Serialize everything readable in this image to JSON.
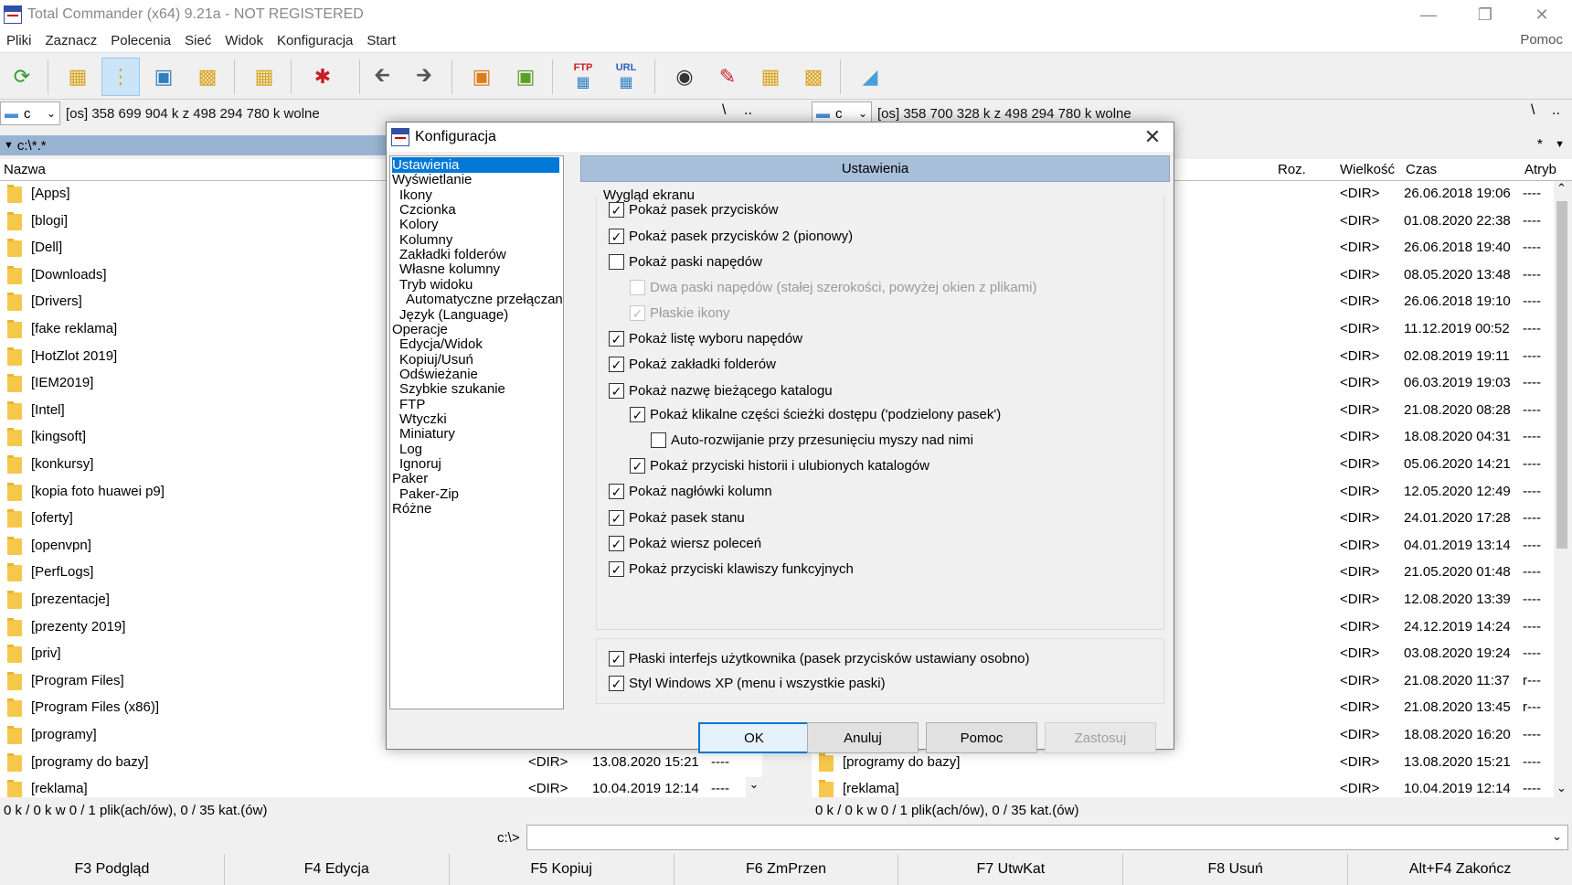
{
  "window": {
    "title": "Total Commander (x64) 9.21a - NOT REGISTERED"
  },
  "menu": {
    "items": [
      "Pliki",
      "Zaznacz",
      "Polecenia",
      "Sieć",
      "Widok",
      "Konfiguracja",
      "Start"
    ],
    "help": "Pomoc"
  },
  "toolbar": {
    "ftp_label": "FTP",
    "url_label": "URL"
  },
  "left_panel": {
    "drive": "c",
    "drive_info": "[os]  358 699 904 k z 498 294 780 k wolne",
    "path_up": "\\",
    "path_dots": "..",
    "path": "c:\\*.*",
    "col_name": "Nazwa",
    "status": "0 k / 0 k w 0 / 1 plik(ach/ów), 0 / 35 kat.(ów)"
  },
  "right_panel": {
    "drive": "c",
    "drive_info": "[os]  358 700 328 k z 498 294 780 k wolne",
    "path_up": "\\",
    "path_dots": "..",
    "star": "*",
    "col_ext": "Roz.",
    "col_size": "Wielkość",
    "col_time": "Czas",
    "col_attr": "Atryb",
    "status": "0 k / 0 k w 0 / 1 plik(ach/ów), 0 / 35 kat.(ów)"
  },
  "files": [
    {
      "name": "[Apps]",
      "size": "<DIR>",
      "time": "26.06.2018 19:06",
      "attr": "----"
    },
    {
      "name": "[blogi]",
      "size": "<DIR>",
      "time": "01.08.2020 22:38",
      "attr": "----"
    },
    {
      "name": "[Dell]",
      "size": "<DIR>",
      "time": "26.06.2018 19:40",
      "attr": "----"
    },
    {
      "name": "[Downloads]",
      "size": "<DIR>",
      "time": "08.05.2020 13:48",
      "attr": "----"
    },
    {
      "name": "[Drivers]",
      "size": "<DIR>",
      "time": "26.06.2018 19:10",
      "attr": "----"
    },
    {
      "name": "[fake reklama]",
      "size": "<DIR>",
      "time": "11.12.2019 00:52",
      "attr": "----"
    },
    {
      "name": "[HotZlot 2019]",
      "size": "<DIR>",
      "time": "02.08.2019 19:11",
      "attr": "----"
    },
    {
      "name": "[IEM2019]",
      "size": "<DIR>",
      "time": "06.03.2019 19:03",
      "attr": "----"
    },
    {
      "name": "[Intel]",
      "size": "<DIR>",
      "time": "21.08.2020 08:28",
      "attr": "----"
    },
    {
      "name": "[kingsoft]",
      "size": "<DIR>",
      "time": "18.08.2020 04:31",
      "attr": "----"
    },
    {
      "name": "[konkursy]",
      "size": "<DIR>",
      "time": "05.06.2020 14:21",
      "attr": "----"
    },
    {
      "name": "[kopia foto huawei p9]",
      "size": "<DIR>",
      "time": "12.05.2020 12:49",
      "attr": "----"
    },
    {
      "name": "[oferty]",
      "size": "<DIR>",
      "time": "24.01.2020 17:28",
      "attr": "----"
    },
    {
      "name": "[openvpn]",
      "size": "<DIR>",
      "time": "04.01.2019 13:14",
      "attr": "----"
    },
    {
      "name": "[PerfLogs]",
      "size": "<DIR>",
      "time": "21.05.2020 01:48",
      "attr": "----"
    },
    {
      "name": "[prezentacje]",
      "size": "<DIR>",
      "time": "12.08.2020 13:39",
      "attr": "----"
    },
    {
      "name": "[prezenty 2019]",
      "size": "<DIR>",
      "time": "24.12.2019 14:24",
      "attr": "----"
    },
    {
      "name": "[priv]",
      "size": "<DIR>",
      "time": "03.08.2020 19:24",
      "attr": "----"
    },
    {
      "name": "[Program Files]",
      "size": "<DIR>",
      "time": "21.08.2020 11:37",
      "attr": "r---"
    },
    {
      "name": "[Program Files (x86)]",
      "size": "<DIR>",
      "time": "21.08.2020 13:45",
      "attr": "r---"
    },
    {
      "name": "[programy]",
      "size": "<DIR>",
      "time": "18.08.2020 16:20",
      "attr": "----"
    },
    {
      "name": "[programy do bazy]",
      "size": "<DIR>",
      "time": "13.08.2020 15:21",
      "attr": "----"
    },
    {
      "name": "[reklama]",
      "size": "<DIR>",
      "time": "10.04.2019 12:14",
      "attr": "----"
    }
  ],
  "cmdline": {
    "label": "c:\\>"
  },
  "fkeys": [
    "F3 Podgląd",
    "F4 Edycja",
    "F5 Kopiuj",
    "F6 ZmPrzen",
    "F7 UtwKat",
    "F8 Usuń",
    "Alt+F4 Zakończ"
  ],
  "dialog": {
    "title": "Konfiguracja",
    "tree": [
      {
        "label": "Ustawienia",
        "level": 0,
        "selected": true
      },
      {
        "label": "Wyświetlanie",
        "level": 0
      },
      {
        "label": "Ikony",
        "level": 1
      },
      {
        "label": "Czcionka",
        "level": 1
      },
      {
        "label": "Kolory",
        "level": 1
      },
      {
        "label": "Kolumny",
        "level": 1
      },
      {
        "label": "Zakładki folderów",
        "level": 1
      },
      {
        "label": "Własne kolumny",
        "level": 1
      },
      {
        "label": "Tryb widoku",
        "level": 1
      },
      {
        "label": "Automatyczne przełączanie",
        "level": 2
      },
      {
        "label": "Język (Language)",
        "level": 1
      },
      {
        "label": "Operacje",
        "level": 0
      },
      {
        "label": "Edycja/Widok",
        "level": 1
      },
      {
        "label": "Kopiuj/Usuń",
        "level": 1
      },
      {
        "label": "Odświeżanie",
        "level": 1
      },
      {
        "label": "Szybkie szukanie",
        "level": 1
      },
      {
        "label": "FTP",
        "level": 1
      },
      {
        "label": "Wtyczki",
        "level": 1
      },
      {
        "label": "Miniatury",
        "level": 1
      },
      {
        "label": "Log",
        "level": 1
      },
      {
        "label": "Ignoruj",
        "level": 1
      },
      {
        "label": "Paker",
        "level": 0
      },
      {
        "label": "Paker-Zip",
        "level": 1
      },
      {
        "label": "Różne",
        "level": 0
      }
    ],
    "section_title": "Ustawienia",
    "group_label": "Wygląd ekranu",
    "options": [
      {
        "label": "Pokaż pasek przycisków",
        "checked": true,
        "indent": 0
      },
      {
        "label": "Pokaż pasek przycisków 2 (pionowy)",
        "checked": true,
        "indent": 0
      },
      {
        "label": "Pokaż paski napędów",
        "checked": false,
        "indent": 0
      },
      {
        "label": "Dwa paski napędów (stałej szerokości, powyżej okien z plikami)",
        "checked": false,
        "indent": 1,
        "disabled": true
      },
      {
        "label": "Płaskie ikony",
        "checked": true,
        "indent": 1,
        "disabled": true
      },
      {
        "label": "Pokaż listę wyboru napędów",
        "checked": true,
        "indent": 0
      },
      {
        "label": "Pokaż zakładki folderów",
        "checked": true,
        "indent": 0
      },
      {
        "label": "Pokaż nazwę bieżącego katalogu",
        "checked": true,
        "indent": 0
      },
      {
        "label": "Pokaż klikalne części ścieżki dostępu ('podzielony pasek')",
        "checked": true,
        "indent": 1
      },
      {
        "label": "Auto-rozwijanie przy przesunięciu myszy nad nimi",
        "checked": false,
        "indent": 2
      },
      {
        "label": "Pokaż przyciski historii i ulubionych katalogów",
        "checked": true,
        "indent": 1
      },
      {
        "label": "Pokaż nagłówki kolumn",
        "checked": true,
        "indent": 0
      },
      {
        "label": "Pokaż pasek stanu",
        "checked": true,
        "indent": 0
      },
      {
        "label": "Pokaż wiersz poleceń",
        "checked": true,
        "indent": 0
      },
      {
        "label": "Pokaż przyciski klawiszy funkcyjnych",
        "checked": true,
        "indent": 0
      }
    ],
    "options2": [
      {
        "label": "Płaski interfejs użytkownika (pasek przycisków ustawiany osobno)",
        "checked": true
      },
      {
        "label": "Styl Windows XP (menu i wszystkie paski)",
        "checked": true
      }
    ],
    "buttons": {
      "ok": "OK",
      "cancel": "Anuluj",
      "help": "Pomoc",
      "apply": "Zastosuj"
    }
  },
  "colors": {
    "accent": "#0078d7",
    "path_bar": "#99b4d1",
    "section_header": "#a8bfd9",
    "folder": "#f5c84c"
  }
}
